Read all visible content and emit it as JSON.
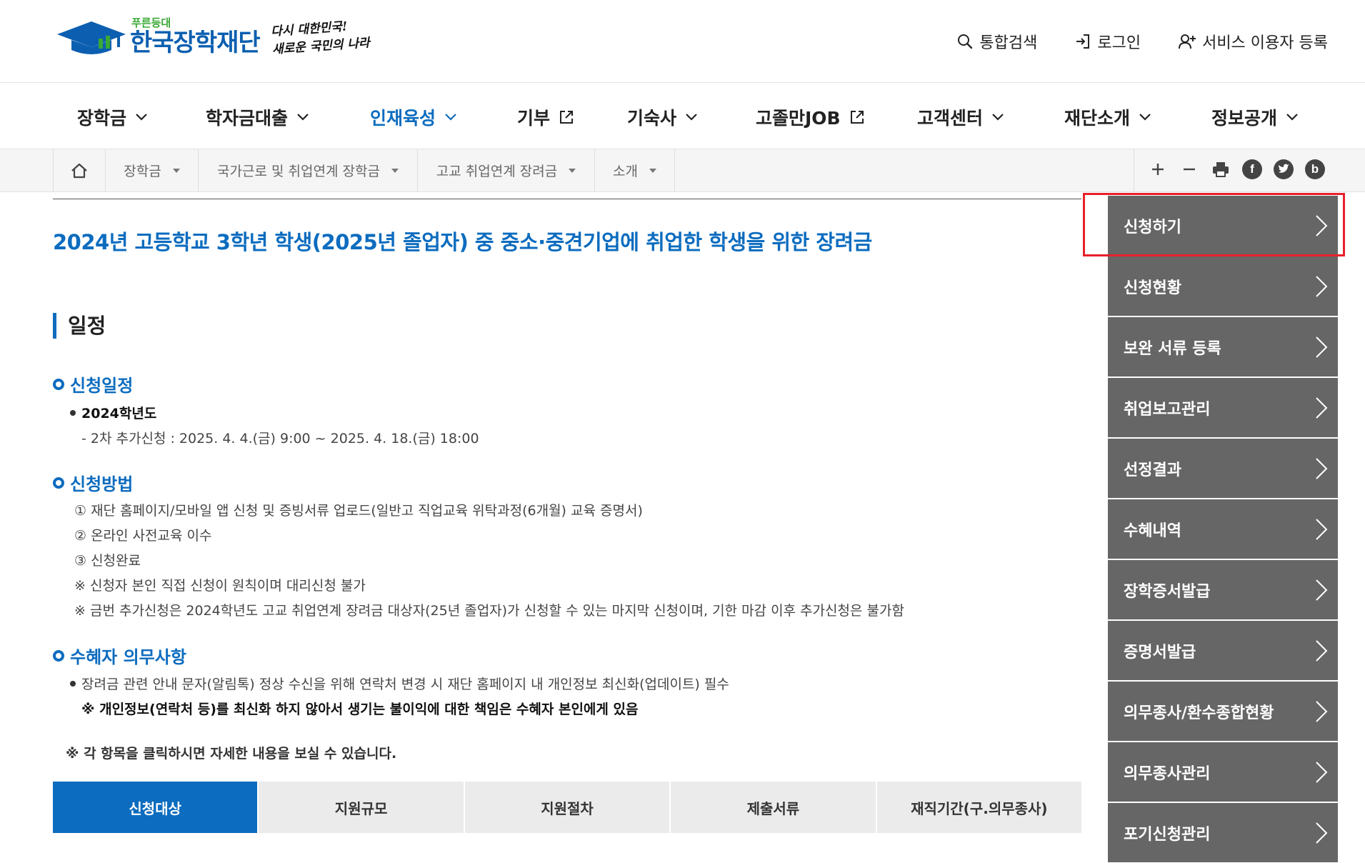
{
  "header": {
    "logo_sub": "푸른등대",
    "logo_main": "한국장학재단",
    "slogan_line1": "다시 대한민국!",
    "slogan_line2": "새로운 국민의 나라",
    "util": {
      "search": "통합검색",
      "login": "로그인",
      "register": "서비스 이용자 등록"
    }
  },
  "gnb": [
    {
      "label": "장학금",
      "icon": "chevron-down-icon"
    },
    {
      "label": "학자금대출",
      "icon": "chevron-down-icon"
    },
    {
      "label": "인재육성",
      "icon": "chevron-down-icon",
      "active": true
    },
    {
      "label": "기부",
      "icon": "external-link-icon"
    },
    {
      "label": "기숙사",
      "icon": "chevron-down-icon"
    },
    {
      "label": "고졸만JOB",
      "icon": "external-link-icon"
    },
    {
      "label": "고객센터",
      "icon": "chevron-down-icon"
    },
    {
      "label": "재단소개",
      "icon": "chevron-down-icon"
    },
    {
      "label": "정보공개",
      "icon": "chevron-down-icon"
    }
  ],
  "breadcrumb": [
    "장학금",
    "국가근로 및 취업연계 장학금",
    "고교 취업연계 장려금",
    "소개"
  ],
  "tools": [
    "plus-icon",
    "minus-icon",
    "print-icon",
    "facebook-icon",
    "twitter-icon",
    "blog-icon"
  ],
  "content": {
    "page_title": "2024년 고등학교 3학년 학생(2025년 졸업자) 중 중소·중견기업에 취업한 학생을 위한 장려금",
    "section_title": "일정",
    "apply_schedule": {
      "heading": "신청일정",
      "year": "2024학년도",
      "detail": "- 2차 추가신청 : 2025. 4. 4.(금) 9:00 ~ 2025. 4. 18.(금) 18:00"
    },
    "apply_method": {
      "heading": "신청방법",
      "steps": [
        "① 재단 홈페이지/모바일 앱 신청 및 증빙서류 업로드(일반고 직업교육 위탁과정(6개월) 교육 증명서)",
        "② 온라인 사전교육 이수",
        "③ 신청완료"
      ],
      "notes": [
        "※ 신청자 본인 직접 신청이 원칙이며 대리신청 불가",
        "※ 금번 추가신청은 2024학년도 고교 취업연계 장려금 대상자(25년 졸업자)가 신청할 수 있는 마지막 신청이며, 기한 마감 이후 추가신청은 불가함"
      ]
    },
    "duty": {
      "heading": "수혜자 의무사항",
      "item": "장려금 관련 안내 문자(알림톡) 정상 수신을 위해 연락처 변경 시 재단 홈페이지 내 개인정보 최신화(업데이트) 필수",
      "warning": "※ 개인정보(연락처 등)를 최신화 하지 않아서 생기는 불이익에 대한 책임은 수혜자 본인에게 있음"
    },
    "click_note": "※ 각 항목을 클릭하시면 자세한 내용을 보실 수 있습니다."
  },
  "tabs": [
    {
      "label": "신청대상",
      "active": true
    },
    {
      "label": "지원규모"
    },
    {
      "label": "지원절차"
    },
    {
      "label": "제출서류"
    },
    {
      "label": "재직기간(구.의무종사)"
    }
  ],
  "side_menu": [
    "신청하기",
    "신청현황",
    "보완 서류 등록",
    "취업보고관리",
    "선정결과",
    "수혜내역",
    "장학증서발급",
    "증명서발급",
    "의무종사/환수종합현황",
    "의무종사관리",
    "포기신청관리"
  ],
  "colors": {
    "primary": "#0c6cbf",
    "logo_blue": "#0c5fb0",
    "logo_green": "#3aa935",
    "side_bg": "#666666",
    "highlight": "#e8202a"
  }
}
